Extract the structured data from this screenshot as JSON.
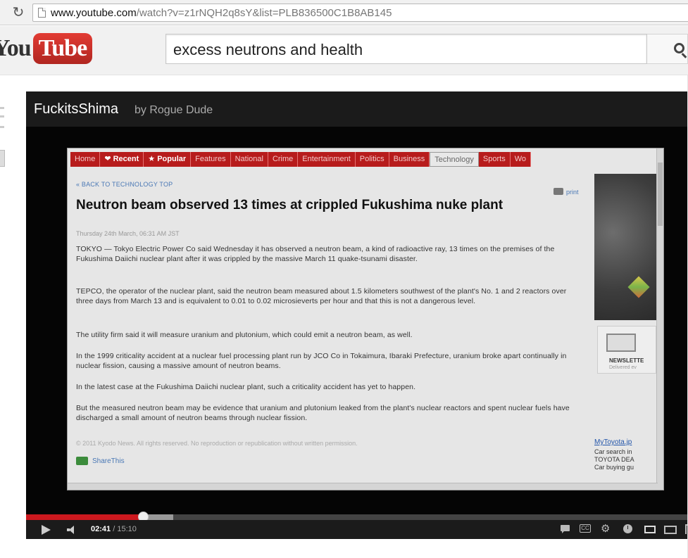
{
  "browser": {
    "url_host": "www.youtube.com",
    "url_rest": "/watch?v=z1rNQH2q8sY&list=PLB836500C1B8AB145"
  },
  "header": {
    "logo_part1": "You",
    "logo_part2": "Tube",
    "search_value": "excess neutrons and health"
  },
  "player": {
    "title": "FuckitsShima",
    "byline": "by Rogue Dude",
    "current_time": "02:41",
    "separator": "/",
    "duration": "15:10",
    "progress_fraction": 0.177,
    "cc_label": "CC"
  },
  "news_page": {
    "nav": [
      "Home",
      "Recent",
      "Popular",
      "Features",
      "National",
      "Crime",
      "Entertainment",
      "Politics",
      "Business",
      "Technology",
      "Sports",
      "Wo"
    ],
    "back_link": "« BACK TO TECHNOLOGY TOP",
    "print": "print",
    "headline": "Neutron beam observed 13 times at crippled Fukushima nuke plant",
    "dateline": "Thursday 24th March, 06:31 AM JST",
    "paragraphs": [
      "TOKYO — Tokyo Electric Power Co said Wednesday it has observed a neutron beam, a kind of radioactive ray, 13 times on the premises of the Fukushima Daiichi nuclear plant after it was crippled by the massive March 11 quake-tsunami disaster.",
      "TEPCO, the operator of the nuclear plant, said the neutron beam measured about 1.5 kilometers southwest of the plant's No. 1 and 2 reactors over three days from March 13 and is equivalent to 0.01 to 0.02 microsieverts per hour and that this is not a dangerous level.",
      "The utility firm said it will measure uranium and plutonium, which could emit a neutron beam, as well.",
      "In the 1999 criticality accident at a nuclear fuel processing plant run by JCO Co in Tokaimura, Ibaraki Prefecture, uranium broke apart continually in nuclear fission, causing a massive amount of neutron beams.",
      "In the latest case at the Fukushima Daiichi nuclear plant, such a criticality accident has yet to happen.",
      "But the measured neutron beam may be evidence that uranium and plutonium leaked from the plant's nuclear reactors and spent nuclear fuels have discharged a small amount of neutron beams through nuclear fission."
    ],
    "copyright": "© 2011 Kyodo News. All rights reserved. No reproduction or republication without written permission.",
    "share": "ShareThis",
    "newsletter": "NEWSLETTE",
    "delivered": "Delivered ev",
    "ad_link": "MyToyota.jp",
    "ad_lines": [
      "Car search in",
      "TOYOTA DEA",
      "Car buying gu"
    ]
  }
}
